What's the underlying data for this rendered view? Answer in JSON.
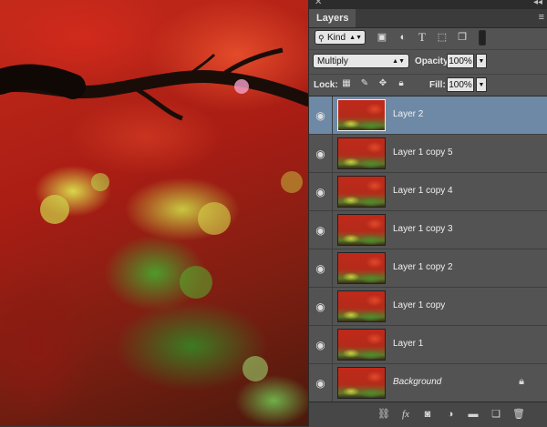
{
  "panel": {
    "tab_label": "Layers",
    "close_glyph": "✕",
    "collapse_glyph": "◂◂",
    "menu_glyph": "≡"
  },
  "filter": {
    "kind_label": "Kind",
    "icons": [
      "image-filter-icon",
      "adjustment-filter-icon",
      "type-filter-icon",
      "shape-filter-icon",
      "smart-object-filter-icon"
    ]
  },
  "blend": {
    "mode": "Multiply",
    "opacity_label": "Opacity:",
    "opacity_value": "100%"
  },
  "lock": {
    "label": "Lock:",
    "fill_label": "Fill:",
    "fill_value": "100%"
  },
  "layers": [
    {
      "name": "Layer 2",
      "selected": true
    },
    {
      "name": "Layer 1 copy 5",
      "selected": false
    },
    {
      "name": "Layer 1 copy 4",
      "selected": false
    },
    {
      "name": "Layer 1 copy 3",
      "selected": false
    },
    {
      "name": "Layer 1 copy 2",
      "selected": false
    },
    {
      "name": "Layer 1 copy",
      "selected": false
    },
    {
      "name": "Layer 1",
      "selected": false
    },
    {
      "name": "Background",
      "selected": false,
      "locked": true
    }
  ],
  "bottom_tools": [
    "link-layers-icon",
    "fx-icon",
    "add-mask-icon",
    "adjustment-layer-icon",
    "new-group-icon",
    "new-layer-icon",
    "delete-layer-icon"
  ],
  "colors": {
    "panel_bg": "#535353",
    "selected_row": "#6e89a6",
    "tab_bar": "#3b3b3b"
  }
}
